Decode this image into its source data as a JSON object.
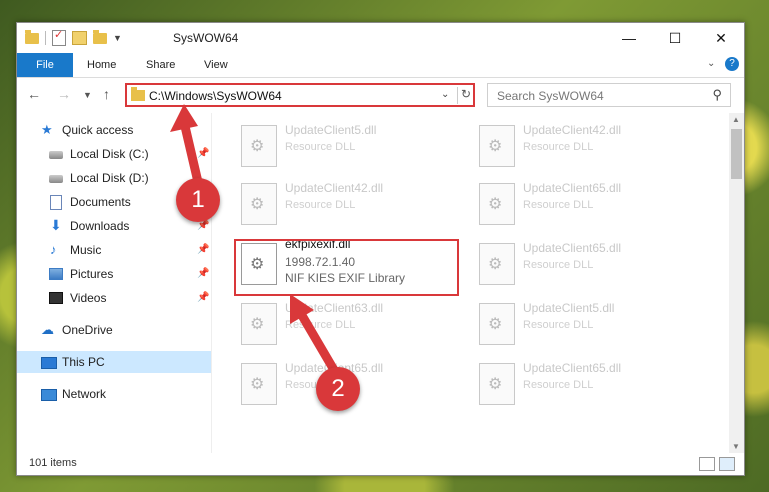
{
  "window": {
    "title": "SysWOW64",
    "controls": {
      "minimize": "—",
      "maximize": "☐",
      "close": "✕"
    }
  },
  "ribbon": {
    "tabs": [
      "File",
      "Home",
      "Share",
      "View"
    ],
    "help": "?"
  },
  "address": {
    "path": "C:\\Windows\\SysWOW64",
    "search_placeholder": "Search SysWOW64"
  },
  "nav": {
    "items": [
      {
        "label": "Quick access",
        "icon": "star-icon",
        "pinned": false
      },
      {
        "label": "Local Disk (C:)",
        "icon": "disk-icon",
        "pinned": true
      },
      {
        "label": "Local Disk (D:)",
        "icon": "disk-icon",
        "pinned": false
      },
      {
        "label": "Documents",
        "icon": "document-icon",
        "pinned": true
      },
      {
        "label": "Downloads",
        "icon": "download-icon",
        "pinned": true
      },
      {
        "label": "Music",
        "icon": "music-icon",
        "pinned": true
      },
      {
        "label": "Pictures",
        "icon": "pictures-icon",
        "pinned": true
      },
      {
        "label": "Videos",
        "icon": "videos-icon",
        "pinned": true
      },
      {
        "label": "OneDrive",
        "icon": "cloud-icon",
        "pinned": false
      },
      {
        "label": "This PC",
        "icon": "pc-icon",
        "pinned": false,
        "selected": true
      },
      {
        "label": "Network",
        "icon": "network-icon",
        "pinned": false
      }
    ]
  },
  "files": [
    {
      "name": "UpdateClient5.dll",
      "type": "Resource DLL"
    },
    {
      "name": "UpdateClient42.dll",
      "type": "Resource DLL"
    },
    {
      "name": "UpdateClient42.dll",
      "type": "Resource DLL"
    },
    {
      "name": "UpdateClient65.dll",
      "type": "Resource DLL"
    },
    {
      "name": "ekfpixexif.dll",
      "version": "1998.72.1.40",
      "type": "NIF KIES EXIF Library"
    },
    {
      "name": "UpdateClient65.dll",
      "type": "Resource DLL"
    },
    {
      "name": "UpdateClient63.dll",
      "type": "Resource DLL"
    },
    {
      "name": "UpdateClient5.dll",
      "type": "Resource DLL"
    },
    {
      "name": "UpdateClient65.dll",
      "type": "Resource DLL"
    },
    {
      "name": "UpdateClient65.dll",
      "type": "Resource DLL"
    }
  ],
  "status": {
    "count": "101 items"
  },
  "callouts": [
    "1",
    "2"
  ],
  "colors": {
    "accent": "#1979ca",
    "highlight": "#d9383a",
    "selected": "#cce8ff"
  }
}
